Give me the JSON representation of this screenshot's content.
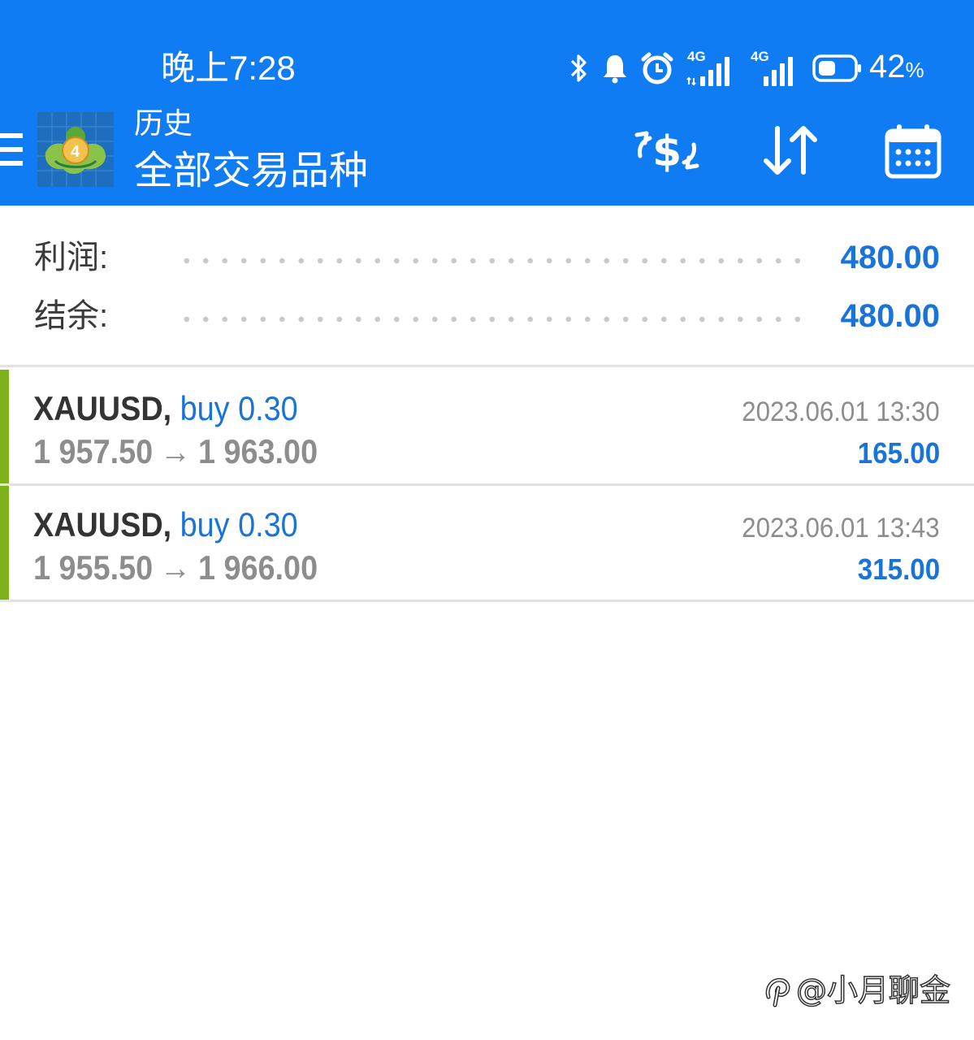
{
  "status_bar": {
    "time": "晚上7:28",
    "network_1": "4G",
    "network_2": "4G",
    "battery_percent": "42",
    "battery_unit": "%",
    "icons": [
      "bluetooth-icon",
      "bell-icon",
      "alarm-icon",
      "signal-icon",
      "signal-icon",
      "battery-icon"
    ]
  },
  "toolbar": {
    "title": "历史",
    "subtitle": "全部交易品种",
    "icons": [
      "menu-icon",
      "mt4-logo",
      "currency-exchange-icon",
      "sort-icon",
      "calendar-icon"
    ]
  },
  "summary": {
    "profit_label": "利润:",
    "profit_value": "480.00",
    "balance_label": "结余:",
    "balance_value": "480.00"
  },
  "trades": [
    {
      "symbol": "XAUUSD,",
      "side": "buy",
      "volume": "0.30",
      "open_price": "1 957.50",
      "arrow": "→",
      "close_price": "1 963.00",
      "time": "2023.06.01 13:30",
      "profit": "165.00"
    },
    {
      "symbol": "XAUUSD,",
      "side": "buy",
      "volume": "0.30",
      "open_price": "1 955.50",
      "arrow": "→",
      "close_price": "1 966.00",
      "time": "2023.06.01 13:43",
      "profit": "315.00"
    }
  ],
  "watermark": {
    "text": "@小月聊金"
  },
  "colors": {
    "header_blue": "#0f7cf4",
    "value_blue": "#1a73d9",
    "buy_stripe_green": "#7db21a",
    "price_gray": "#8d8d8d"
  }
}
